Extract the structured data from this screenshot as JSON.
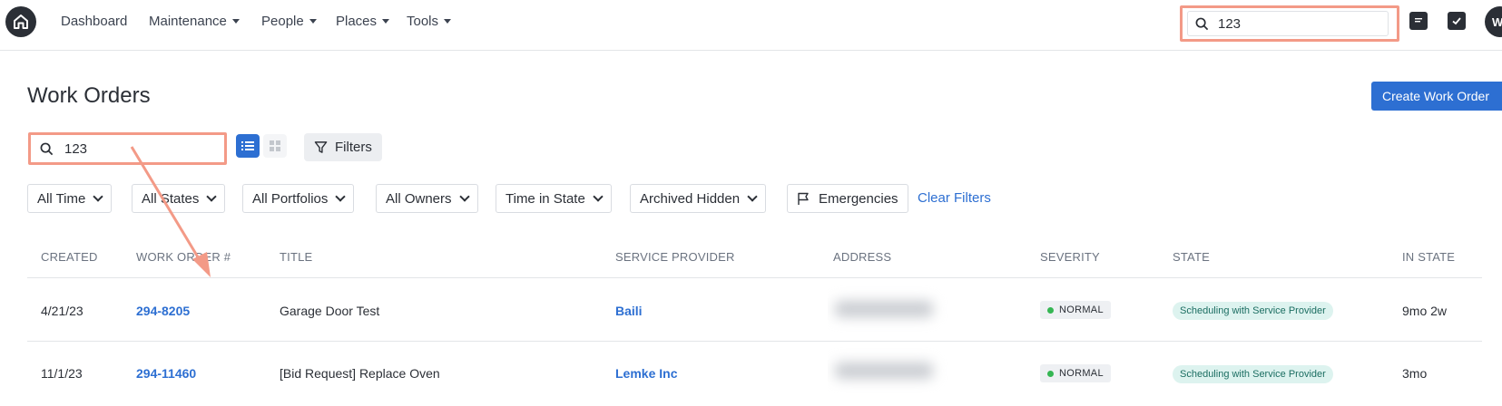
{
  "nav": {
    "items": [
      {
        "label": "Dashboard",
        "dropdown": false
      },
      {
        "label": "Maintenance",
        "dropdown": true
      },
      {
        "label": "People",
        "dropdown": true
      },
      {
        "label": "Places",
        "dropdown": true
      },
      {
        "label": "Tools",
        "dropdown": true
      }
    ],
    "global_search_value": "123",
    "avatar_initial": "W"
  },
  "page": {
    "title": "Work Orders",
    "create_button": "Create Work Order"
  },
  "toolbar": {
    "search_value": "123",
    "filters_label": "Filters",
    "view_mode": "list"
  },
  "filter_chips": [
    {
      "label": "All Time"
    },
    {
      "label": "All States"
    },
    {
      "label": "All Portfolios"
    },
    {
      "label": "All Owners"
    },
    {
      "label": "Time in State"
    },
    {
      "label": "Archived Hidden"
    }
  ],
  "emergencies_label": "Emergencies",
  "clear_filters_label": "Clear Filters",
  "table": {
    "columns": [
      "CREATED",
      "WORK ORDER #",
      "TITLE",
      "SERVICE PROVIDER",
      "ADDRESS",
      "SEVERITY",
      "STATE",
      "IN STATE"
    ],
    "rows": [
      {
        "created": "4/21/23",
        "work_order": "294-8205",
        "title": "Garage Door Test",
        "service_provider": "Baili",
        "severity": "NORMAL",
        "state": "Scheduling with Service Provider",
        "in_state": "9mo 2w"
      },
      {
        "created": "11/1/23",
        "work_order": "294-11460",
        "title": "[Bid Request] Replace Oven",
        "service_provider": "Lemke Inc",
        "severity": "NORMAL",
        "state": "Scheduling with Service Provider",
        "in_state": "3mo"
      }
    ]
  },
  "colors": {
    "accent": "#2d6fd2",
    "highlight": "#f39a87",
    "severity_normal": "#35b653",
    "state_badge_bg": "#ddf3ef"
  }
}
